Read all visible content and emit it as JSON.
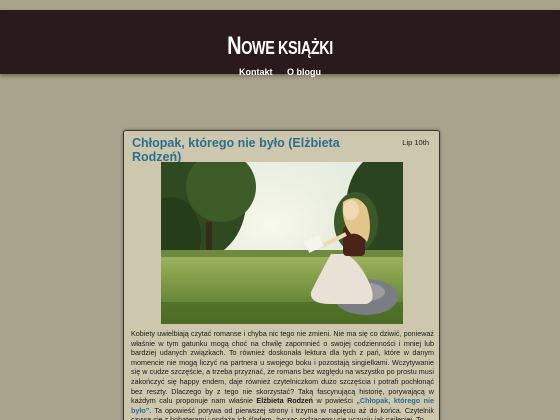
{
  "site": {
    "title_first": "N",
    "title_rest": "owe książki",
    "nav": [
      "Kontakt",
      "O blogu"
    ]
  },
  "post": {
    "title": "Chłopak, którego nie było (Elżbieta Rodzeń)",
    "date": "Lip 10th",
    "image_alt": "",
    "body": {
      "text1": "Kobiety uwielbiają czytać romanse i chyba nic tego nie zmieni. Nie ma się co dziwić, ponieważ właśnie w tym gatunku mogą choć na chwilę zapomnieć o swojej codzienności i mniej lub bardziej udanych związkach. To również doskonała lektura dla tych z pań, które w danym momencie nie mogą liczyć na partnera u swojego boku i pozostają singielkami. Wczytywanie się w cudze szczęście, a trzeba przyznać, że romans bez względu na wszystko po prostu musi zakończyć się happy endem, daje również czytelniczkom dużo szczęścia i potrafi pochłonąć bez reszty. Dlaczego by z tego nie skorzystać? Taką fascynującą historię, porywającą w każdym calu proponuje nam właśnie ",
      "author": "Elżbieta Rodzeń",
      "text2": " w powieści ",
      "book_link": "„Chłopak, którego nie było”",
      "text3": ". Ta opowieść porywa od pierwszej strony i trzyma w napięciu aż do końca. Czytelnik czuwa się z bohaterami i podąża ich śladem, życząc rodzącemu się uczuciu jak najlepiej. To"
    }
  },
  "colors": {
    "background": "#a8a38c",
    "header": "#2a1a1b",
    "post_bg": "#cdc7ad",
    "link": "#2d6e8e"
  }
}
